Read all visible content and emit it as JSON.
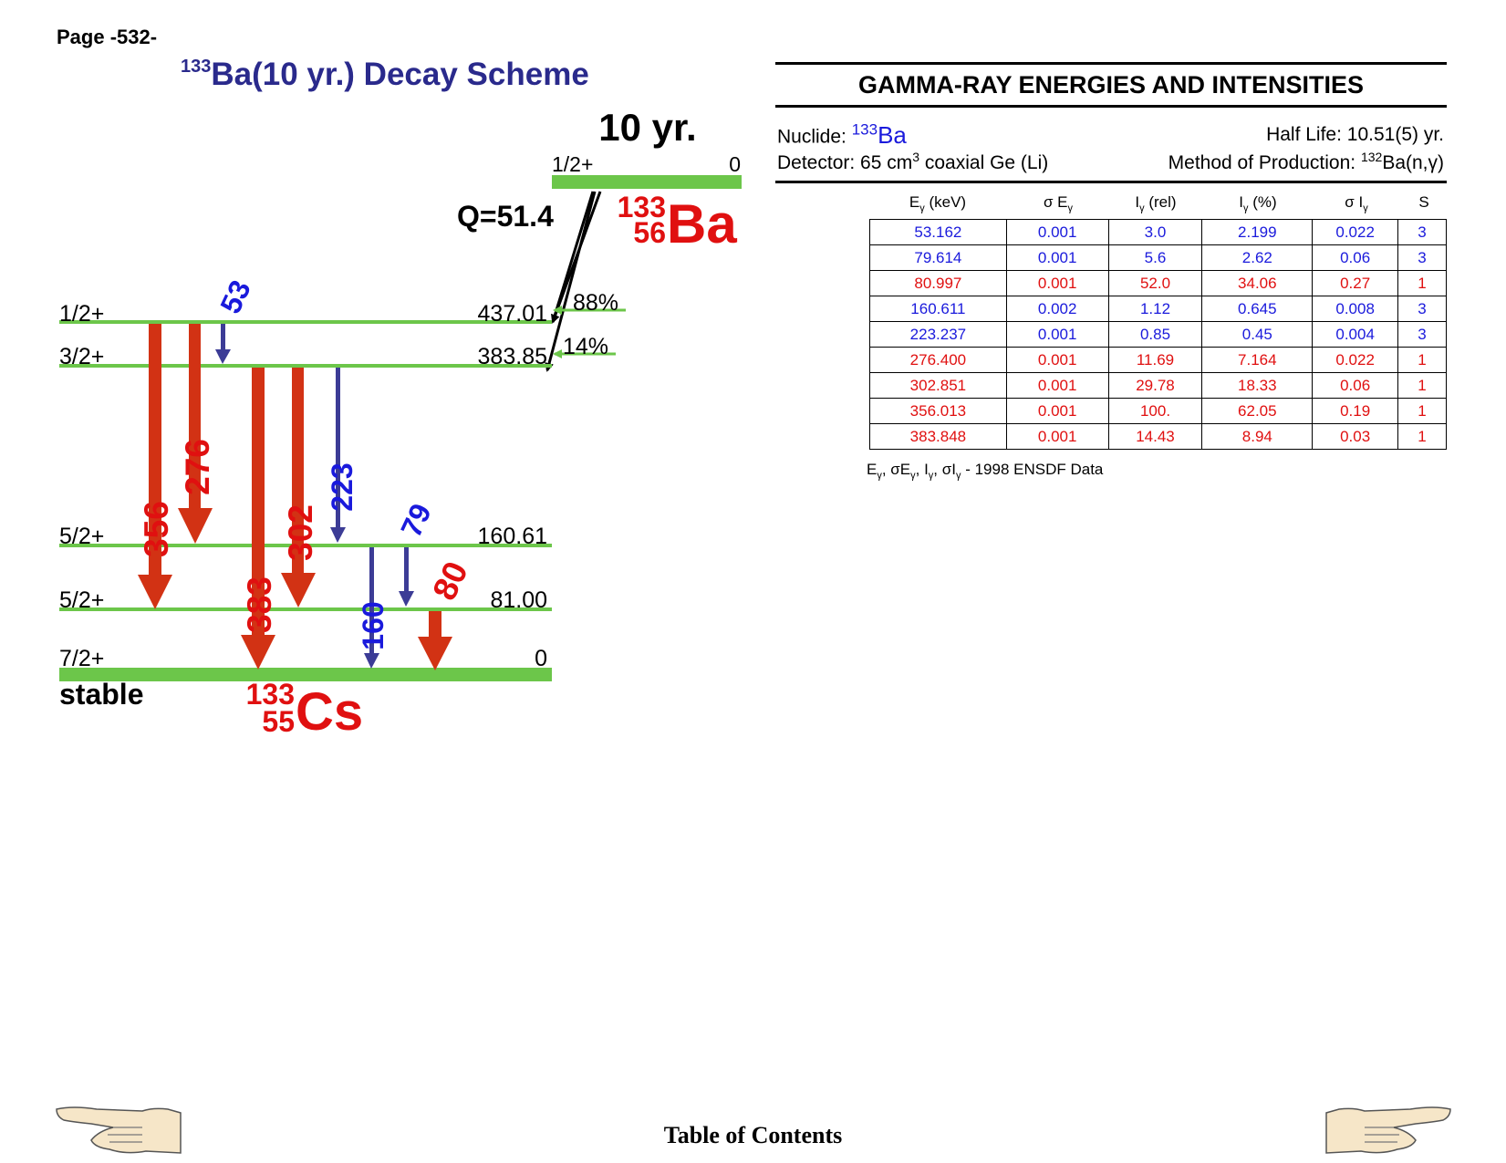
{
  "page": {
    "number": "Page -532-"
  },
  "title": {
    "isotope_mass": "133",
    "text": "Ba(10 yr.) Decay Scheme"
  },
  "colors": {
    "title": "#2a2a8c",
    "red": "#e01010",
    "blue": "#1a1adc",
    "level": "#6cc64a",
    "arrow_red": "#d23214",
    "arrow_blue": "#3c3c96"
  },
  "scheme": {
    "parent": {
      "half_life": "10 yr.",
      "spin": "1/2+",
      "energy": "0",
      "mass": "133",
      "z": "56",
      "symbol": "Ba",
      "q_value": "Q=51.4"
    },
    "branches": [
      {
        "label": "88%"
      },
      {
        "label": "14%"
      }
    ],
    "levels": [
      {
        "spin": "1/2+",
        "energy": "437.01"
      },
      {
        "spin": "3/2+",
        "energy": "383.85"
      },
      {
        "spin": "5/2+",
        "energy": "160.61"
      },
      {
        "spin": "5/2+",
        "energy": "81.00"
      },
      {
        "spin": "7/2+",
        "energy": "0"
      }
    ],
    "daughter": {
      "stability": "stable",
      "mass": "133",
      "z": "55",
      "symbol": "Cs"
    },
    "transitions": [
      {
        "label": "356",
        "color": "red"
      },
      {
        "label": "276",
        "color": "red"
      },
      {
        "label": "53",
        "color": "blue"
      },
      {
        "label": "383",
        "color": "red"
      },
      {
        "label": "302",
        "color": "red"
      },
      {
        "label": "223",
        "color": "blue"
      },
      {
        "label": "160",
        "color": "blue"
      },
      {
        "label": "79",
        "color": "blue"
      },
      {
        "label": "80",
        "color": "red"
      }
    ]
  },
  "table": {
    "title": "GAMMA-RAY ENERGIES AND INTENSITIES",
    "nuclide_label": "Nuclide:",
    "nuclide_mass": "133",
    "nuclide_symbol": "Ba",
    "half_life": "Half Life: 10.51(5) yr.",
    "detector_label": "Detector: 65 cm",
    "detector_sup": "3",
    "detector_rest": " coaxial Ge (Li)",
    "method_label": "Method of Production: ",
    "method_sup": "132",
    "method_rest": "Ba(n,γ)",
    "headers": {
      "energy": "E",
      "energy_sub": "γ",
      "energy_unit": " (keV)",
      "sigma_e": "σ E",
      "sigma_e_sub": "γ",
      "i_rel": "I",
      "i_rel_sub": "γ",
      "i_rel_unit": " (rel)",
      "i_pct": "I",
      "i_pct_sub": "γ",
      "i_pct_unit": " (%)",
      "sigma_i": "σ I",
      "sigma_i_sub": "γ",
      "s": "S"
    },
    "rows": [
      {
        "e": "53.162",
        "se": "0.001",
        "irel": "3.0",
        "ipct": "2.199",
        "si": "0.022",
        "s": "3",
        "color": "blue"
      },
      {
        "e": "79.614",
        "se": "0.001",
        "irel": "5.6",
        "ipct": "2.62",
        "si": "0.06",
        "s": "3",
        "color": "blue"
      },
      {
        "e": "80.997",
        "se": "0.001",
        "irel": "52.0",
        "ipct": "34.06",
        "si": "0.27",
        "s": "1",
        "color": "red"
      },
      {
        "e": "160.611",
        "se": "0.002",
        "irel": "1.12",
        "ipct": "0.645",
        "si": "0.008",
        "s": "3",
        "color": "blue"
      },
      {
        "e": "223.237",
        "se": "0.001",
        "irel": "0.85",
        "ipct": "0.45",
        "si": "0.004",
        "s": "3",
        "color": "blue"
      },
      {
        "e": "276.400",
        "se": "0.001",
        "irel": "11.69",
        "ipct": "7.164",
        "si": "0.022",
        "s": "1",
        "color": "red"
      },
      {
        "e": "302.851",
        "se": "0.001",
        "irel": "29.78",
        "ipct": "18.33",
        "si": "0.06",
        "s": "1",
        "color": "red"
      },
      {
        "e": "356.013",
        "se": "0.001",
        "irel": "100.",
        "ipct": "62.05",
        "si": "0.19",
        "s": "1",
        "color": "red"
      },
      {
        "e": "383.848",
        "se": "0.001",
        "irel": "14.43",
        "ipct": "8.94",
        "si": "0.03",
        "s": "1",
        "color": "red"
      }
    ],
    "note": {
      "e": "E",
      "e_sub": "γ",
      "se": ", σE",
      "se_sub": "γ",
      "i": ", I",
      "i_sub": "γ",
      "si": ", σI",
      "si_sub": "γ",
      "dash": " - ",
      "source": " 1998 ENSDF Data"
    }
  },
  "footer": {
    "toc": "Table of Contents"
  }
}
